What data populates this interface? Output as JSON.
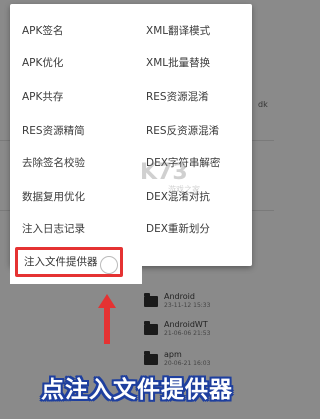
{
  "menu": {
    "left_items": [
      "APK签名",
      "APK优化",
      "APK共存",
      "RES资源精简",
      "去除签名校验",
      "数据复用优化",
      "注入日志记录"
    ],
    "right_items": [
      "XML翻译模式",
      "XML批量替换",
      "RES资源混淆",
      "RES反资源混淆",
      "DEX字符串解密",
      "DEX混淆对抗",
      "DEX重新划分"
    ],
    "highlighted_item": "注入文件提供器"
  },
  "file_list": [
    {
      "name": "Android",
      "date": "23-11-12 15:33"
    },
    {
      "name": "AndroidWT",
      "date": "21-06-06 21:53"
    },
    {
      "name": "apm",
      "date": "20-06-21 16:03"
    }
  ],
  "caption": "点注入文件提供器",
  "watermark": {
    "text": "K73",
    "sub": "游戏之家"
  },
  "colors": {
    "highlight": "#e53232",
    "caption_outline": "#1e3f9e",
    "overlay_bg": "#8a8a8a"
  }
}
